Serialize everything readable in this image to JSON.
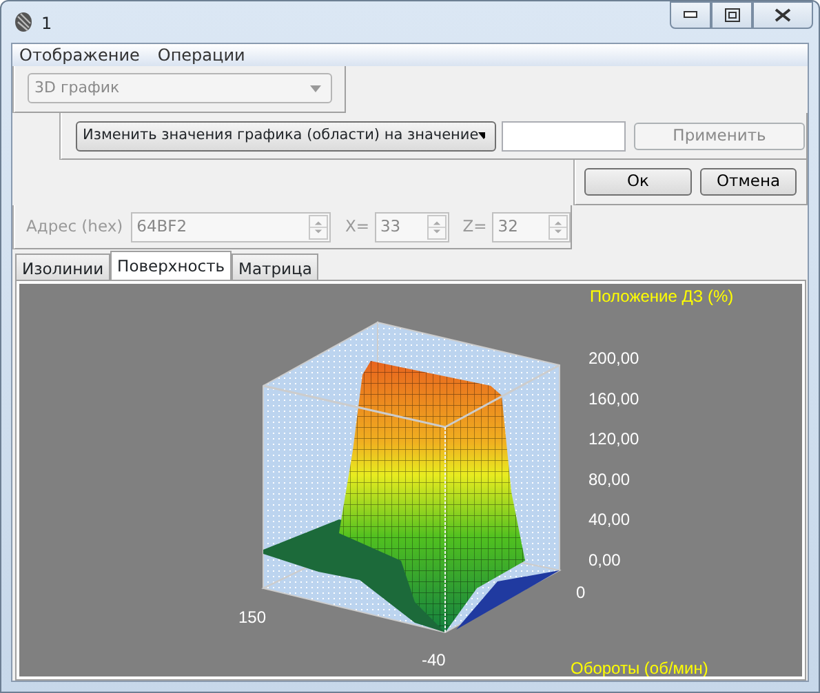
{
  "window": {
    "title": "1"
  },
  "menu": [
    {
      "label": "Отображение"
    },
    {
      "label": "Операции"
    }
  ],
  "view_select": {
    "value": "3D график",
    "disabled": true
  },
  "operation": {
    "select": "Изменить значения графика (области) на значение",
    "apply_button": {
      "label": "Применить",
      "disabled": true
    }
  },
  "buttons": [
    {
      "label": "Ок"
    },
    {
      "label": "Отмена"
    }
  ],
  "coordinates": {
    "disabled": true,
    "fields": [
      {
        "label": "Адрес (hex)",
        "value": "64BF2"
      },
      {
        "label": "X=",
        "value": "33"
      },
      {
        "label": "Z=",
        "value": "32"
      }
    ]
  },
  "tabs": [
    {
      "label": "Изолинии",
      "selected": false
    },
    {
      "label": "Поверхность",
      "selected": true
    },
    {
      "label": "Матрица",
      "selected": false
    }
  ],
  "chart": {
    "z_title": "Положение ДЗ (%)",
    "z_ticks": [
      "200,00",
      "160,00",
      "120,00",
      "80,00",
      "40,00",
      "0,00"
    ],
    "x_title": "Обороты (об/мин)",
    "axis_labels": [
      {
        "kind": "right",
        "text": "0"
      },
      {
        "kind": "left",
        "text": "150"
      },
      {
        "kind": "front",
        "text": "-40"
      }
    ]
  }
}
